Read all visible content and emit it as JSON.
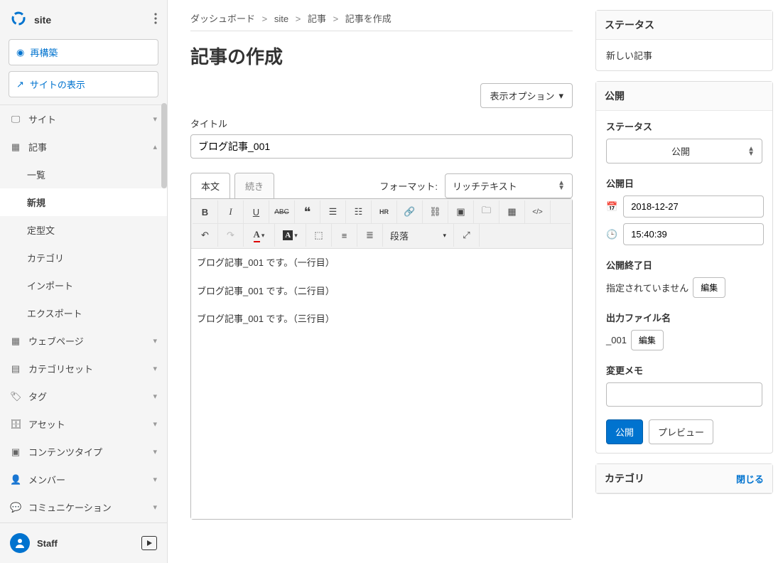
{
  "sidebar": {
    "site_name": "site",
    "rebuild": "再構築",
    "view_site": "サイトの表示",
    "nav": {
      "site": "サイト",
      "articles": "記事",
      "articles_sub": {
        "list": "一覧",
        "new": "新規",
        "boilerplate": "定型文",
        "category": "カテゴリ",
        "import": "インポート",
        "export": "エクスポート"
      },
      "webpage": "ウェブページ",
      "category_set": "カテゴリセット",
      "tag": "タグ",
      "asset": "アセット",
      "content_type": "コンテンツタイプ",
      "member": "メンバー",
      "communication": "コミュニケーション"
    },
    "staff": "Staff"
  },
  "breadcrumb": {
    "dashboard": "ダッシュボード",
    "site": "site",
    "articles": "記事",
    "create": "記事を作成"
  },
  "main": {
    "page_title": "記事の作成",
    "display_options": "表示オプション",
    "title_label": "タイトル",
    "title_value": "ブログ記事_001",
    "tab_body": "本文",
    "tab_more": "続き",
    "format_label": "フォーマット:",
    "format_value": "リッチテキスト",
    "toolbar": {
      "paragraph": "段落"
    },
    "body": {
      "line1": "ブログ記事_001 です。（一行目）",
      "line2": "ブログ記事_001 です。（二行目）",
      "line3": "ブログ記事_001 です。（三行目）"
    }
  },
  "right": {
    "status_header": "ステータス",
    "status_value": "新しい記事",
    "publish_header": "公開",
    "status_label": "ステータス",
    "status_select": "公開",
    "publish_date_label": "公開日",
    "publish_date": "2018-12-27",
    "publish_time": "15:40:39",
    "end_date_label": "公開終了日",
    "end_date_value": "指定されていません",
    "edit_btn": "編集",
    "filename_label": "出力ファイル名",
    "filename_value": "_001",
    "memo_label": "変更メモ",
    "publish_btn": "公開",
    "preview_btn": "プレビュー",
    "category_header": "カテゴリ",
    "close": "閉じる"
  }
}
